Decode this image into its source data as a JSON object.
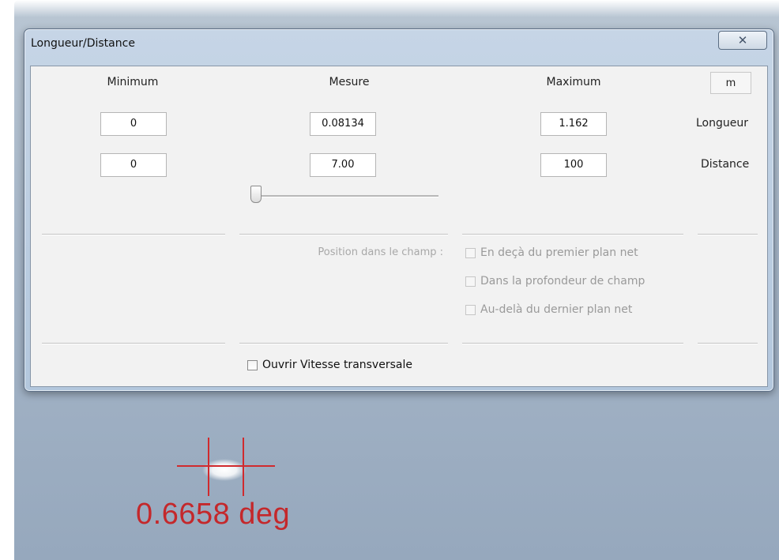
{
  "window": {
    "title": "Longueur/Distance",
    "close_label": "✕"
  },
  "headers": {
    "minimum": "Minimum",
    "mesure": "Mesure",
    "maximum": "Maximum",
    "unit": "m"
  },
  "rows": {
    "longueur": {
      "label": "Longueur",
      "min": "0",
      "mesure": "0.08134",
      "max": "1.162"
    },
    "distance": {
      "label": "Distance",
      "min": "0",
      "mesure": "7.00",
      "max": "100"
    }
  },
  "slider": {
    "value_fraction": 0.0
  },
  "position": {
    "label": "Position dans le champ :",
    "options": [
      "En deçà du premier plan net",
      "Dans la profondeur de champ",
      "Au-delà du dernier plan net"
    ]
  },
  "vitesse": {
    "label": "Ouvrir Vitesse transversale",
    "checked": false
  },
  "overlay": {
    "readout": "0.6658 deg",
    "color": "#c4282b"
  }
}
